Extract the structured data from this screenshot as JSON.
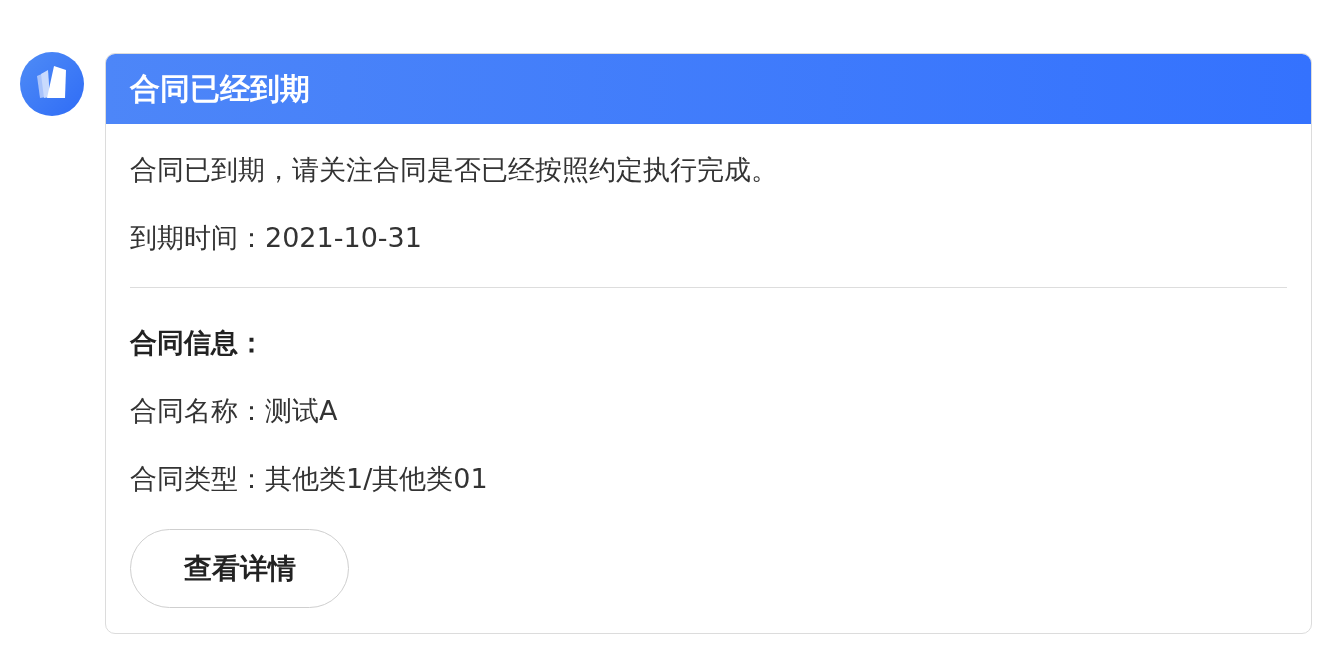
{
  "card": {
    "title": "合同已经到期",
    "message": "合同已到期，请关注合同是否已经按照约定执行完成。",
    "due_line": "到期时间：2021-10-31",
    "section_title": "合同信息：",
    "info_lines": [
      "合同名称：测试A",
      "合同类型：其他类1/其他类01"
    ],
    "button": "查看详情"
  }
}
